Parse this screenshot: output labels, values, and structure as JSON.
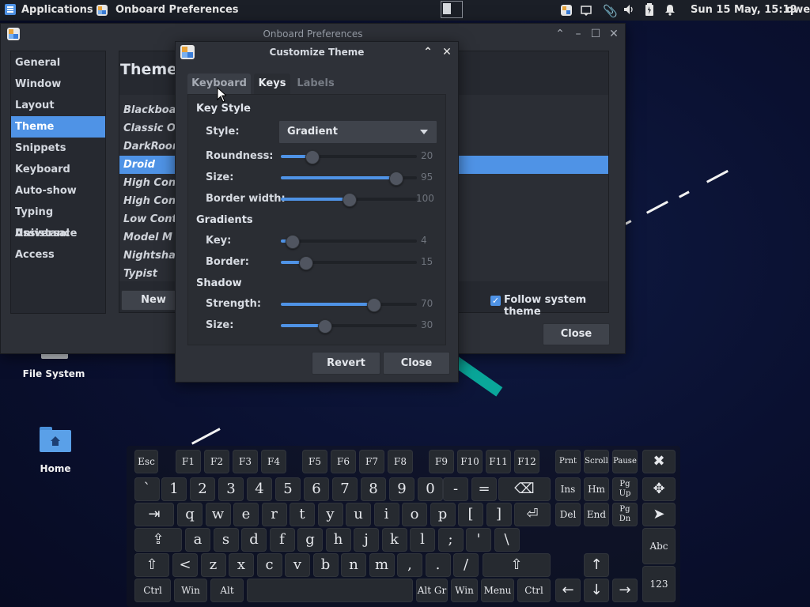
{
  "panel": {
    "applications": "Applications",
    "active_window": "Onboard Preferences",
    "clock": "Sun 15 May, 15:19",
    "user": "qwe"
  },
  "desktop": {
    "icons": [
      {
        "label": "File System"
      },
      {
        "label": "Home"
      }
    ]
  },
  "prefs": {
    "title": "Onboard Preferences",
    "sidebar": [
      "General",
      "Window",
      "Layout",
      "Theme",
      "Snippets",
      "Keyboard",
      "Auto-show",
      "Typing Assistance",
      "Universal Access"
    ],
    "selected_sidebar": "Theme",
    "heading": "Theme",
    "themes": [
      "Blackboar",
      "Classic On",
      "DarkRoom",
      "Droid",
      "High Contr",
      "High Contr",
      "Low Contr",
      "Model M",
      "Nightshad",
      "Typist"
    ],
    "selected_theme": "Droid",
    "new_button": "New",
    "follow_system": "Follow system theme",
    "follow_checked": true,
    "close_button": "Close"
  },
  "customize": {
    "title": "Customize Theme",
    "tabs": [
      "Keyboard",
      "Keys",
      "Labels"
    ],
    "active_tab": "Keys",
    "key_style": {
      "title": "Key Style",
      "style_label": "Style:",
      "style_value": "Gradient",
      "roundness": {
        "label": "Roundness:",
        "value": "20",
        "fraction": 0.2
      },
      "size": {
        "label": "Size:",
        "value": "95",
        "fraction": 0.88
      },
      "border_width": {
        "label": "Border width:",
        "value": "100",
        "fraction": 0.5
      }
    },
    "gradients": {
      "title": "Gradients",
      "key": {
        "label": "Key:",
        "value": "4",
        "fraction": 0.04
      },
      "border": {
        "label": "Border:",
        "value": "15",
        "fraction": 0.15
      }
    },
    "shadow": {
      "title": "Shadow",
      "strength": {
        "label": "Strength:",
        "value": "70",
        "fraction": 0.7
      },
      "size": {
        "label": "Size:",
        "value": "30",
        "fraction": 0.3
      }
    },
    "revert_button": "Revert",
    "close_button": "Close"
  },
  "keyboard": {
    "row_f": [
      "Esc",
      "F1",
      "F2",
      "F3",
      "F4",
      "F5",
      "F6",
      "F7",
      "F8",
      "F9",
      "F10",
      "F11",
      "F12"
    ],
    "row_num": [
      "`",
      "1",
      "2",
      "3",
      "4",
      "5",
      "6",
      "7",
      "8",
      "9",
      "0",
      "-",
      "="
    ],
    "row_q": [
      "q",
      "w",
      "e",
      "r",
      "t",
      "y",
      "u",
      "i",
      "o",
      "p",
      "[",
      "]"
    ],
    "row_a": [
      "a",
      "s",
      "d",
      "f",
      "g",
      "h",
      "j",
      "k",
      "l",
      ";",
      "'",
      "\\"
    ],
    "row_z": [
      "<",
      "z",
      "x",
      "c",
      "v",
      "b",
      "n",
      "m",
      ",",
      ".",
      "/"
    ],
    "row_bottom": [
      "Ctrl",
      "Win",
      "Alt",
      "Alt Gr",
      "Win",
      "Menu",
      "Ctrl"
    ],
    "nav": [
      "Prnt",
      "Scroll",
      "Pause",
      "Ins",
      "Hm",
      "Pg Up",
      "Del",
      "End",
      "Pg Dn"
    ],
    "special": [
      "Abc",
      "123"
    ]
  }
}
